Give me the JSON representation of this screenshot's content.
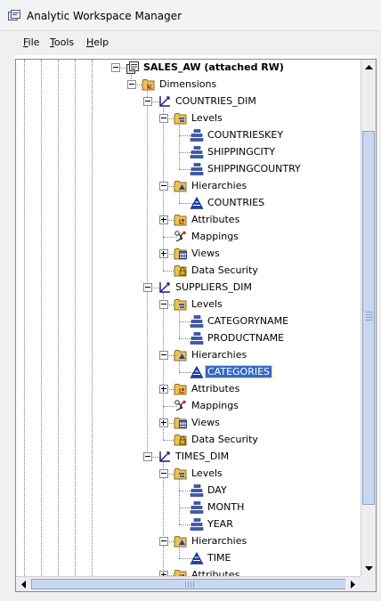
{
  "window": {
    "title": "Analytic Workspace Manager"
  },
  "menu": [
    {
      "label": "File",
      "mnemonic_index": 0
    },
    {
      "label": "Tools",
      "mnemonic_index": 0
    },
    {
      "label": "Help",
      "mnemonic_index": 0
    }
  ],
  "tree": {
    "nodes": [
      {
        "label": "SALES_AW (attached RW)",
        "level": 0,
        "icon": "workspace-icon",
        "toggle": "minus",
        "bold": true
      },
      {
        "label": "Dimensions",
        "level": 1,
        "icon": "dimensions-folder-icon",
        "toggle": "minus"
      },
      {
        "label": "COUNTRIES_DIM",
        "level": 2,
        "icon": "dimension-icon",
        "toggle": "minus"
      },
      {
        "label": "Levels",
        "level": 3,
        "icon": "levels-folder-icon",
        "toggle": "minus"
      },
      {
        "label": "COUNTRIESKEY",
        "level": 4,
        "icon": "level-icon",
        "toggle": "none"
      },
      {
        "label": "SHIPPINGCITY",
        "level": 4,
        "icon": "level-icon",
        "toggle": "none"
      },
      {
        "label": "SHIPPINGCOUNTRY",
        "level": 4,
        "icon": "level-icon",
        "toggle": "none"
      },
      {
        "label": "Hierarchies",
        "level": 3,
        "icon": "hierarchies-folder-icon",
        "toggle": "minus"
      },
      {
        "label": "COUNTRIES",
        "level": 4,
        "icon": "hierarchy-icon",
        "toggle": "none"
      },
      {
        "label": "Attributes",
        "level": 3,
        "icon": "attributes-folder-icon",
        "toggle": "plus"
      },
      {
        "label": "Mappings",
        "level": 3,
        "icon": "mappings-icon",
        "toggle": "none"
      },
      {
        "label": "Views",
        "level": 3,
        "icon": "views-folder-icon",
        "toggle": "plus"
      },
      {
        "label": "Data Security",
        "level": 3,
        "icon": "data-security-icon",
        "toggle": "none"
      },
      {
        "label": "SUPPLIERS_DIM",
        "level": 2,
        "icon": "dimension-icon",
        "toggle": "minus"
      },
      {
        "label": "Levels",
        "level": 3,
        "icon": "levels-folder-icon",
        "toggle": "minus"
      },
      {
        "label": "CATEGORYNAME",
        "level": 4,
        "icon": "level-icon",
        "toggle": "none"
      },
      {
        "label": "PRODUCTNAME",
        "level": 4,
        "icon": "level-icon",
        "toggle": "none"
      },
      {
        "label": "Hierarchies",
        "level": 3,
        "icon": "hierarchies-folder-icon",
        "toggle": "minus"
      },
      {
        "label": "CATEGORIES",
        "level": 4,
        "icon": "hierarchy-icon",
        "toggle": "none",
        "selected": true
      },
      {
        "label": "Attributes",
        "level": 3,
        "icon": "attributes-folder-icon",
        "toggle": "plus"
      },
      {
        "label": "Mappings",
        "level": 3,
        "icon": "mappings-icon",
        "toggle": "none"
      },
      {
        "label": "Views",
        "level": 3,
        "icon": "views-folder-icon",
        "toggle": "plus"
      },
      {
        "label": "Data Security",
        "level": 3,
        "icon": "data-security-icon",
        "toggle": "none"
      },
      {
        "label": "TIMES_DIM",
        "level": 2,
        "icon": "dimension-icon",
        "toggle": "minus"
      },
      {
        "label": "Levels",
        "level": 3,
        "icon": "levels-folder-icon",
        "toggle": "minus"
      },
      {
        "label": "DAY",
        "level": 4,
        "icon": "level-icon",
        "toggle": "none"
      },
      {
        "label": "MONTH",
        "level": 4,
        "icon": "level-icon",
        "toggle": "none"
      },
      {
        "label": "YEAR",
        "level": 4,
        "icon": "level-icon",
        "toggle": "none"
      },
      {
        "label": "Hierarchies",
        "level": 3,
        "icon": "hierarchies-folder-icon",
        "toggle": "minus"
      },
      {
        "label": "TIME",
        "level": 4,
        "icon": "hierarchy-icon",
        "toggle": "none"
      },
      {
        "label": "Attributes",
        "level": 3,
        "icon": "attributes-folder-icon",
        "toggle": "plus"
      }
    ]
  },
  "colors": {
    "selection": "#3569c4",
    "selection_border": "#d8b03a",
    "scroll_thumb": "#c8d6ee",
    "folder": "#e8c25a",
    "hierarchy_blue": "#1f3fa8"
  }
}
